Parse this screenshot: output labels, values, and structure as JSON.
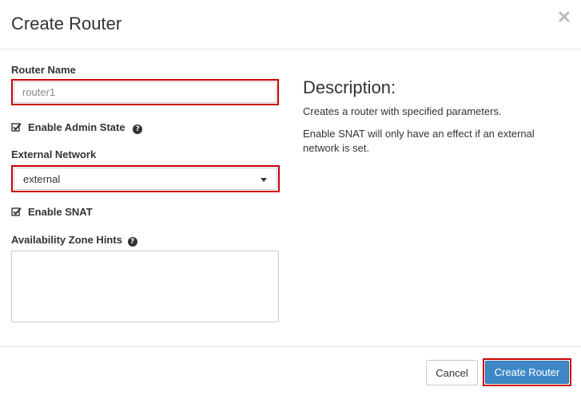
{
  "modal": {
    "title": "Create Router",
    "close_icon": "close-icon"
  },
  "form": {
    "router_name": {
      "label": "Router Name",
      "value": "router1"
    },
    "admin_state": {
      "label": "Enable Admin State",
      "checked": true,
      "help_icon": "question-circle-icon"
    },
    "external_network": {
      "label": "External Network",
      "selected": "external"
    },
    "snat": {
      "label": "Enable SNAT",
      "checked": true
    },
    "az_hints": {
      "label": "Availability Zone Hints",
      "help_icon": "question-circle-icon"
    }
  },
  "description": {
    "title": "Description:",
    "paragraphs": [
      "Creates a router with specified parameters.",
      "Enable SNAT will only have an effect if an external network is set."
    ]
  },
  "footer": {
    "cancel_label": "Cancel",
    "submit_label": "Create Router"
  },
  "colors": {
    "primary": "#3f88c8",
    "highlight": "#cc0000"
  }
}
